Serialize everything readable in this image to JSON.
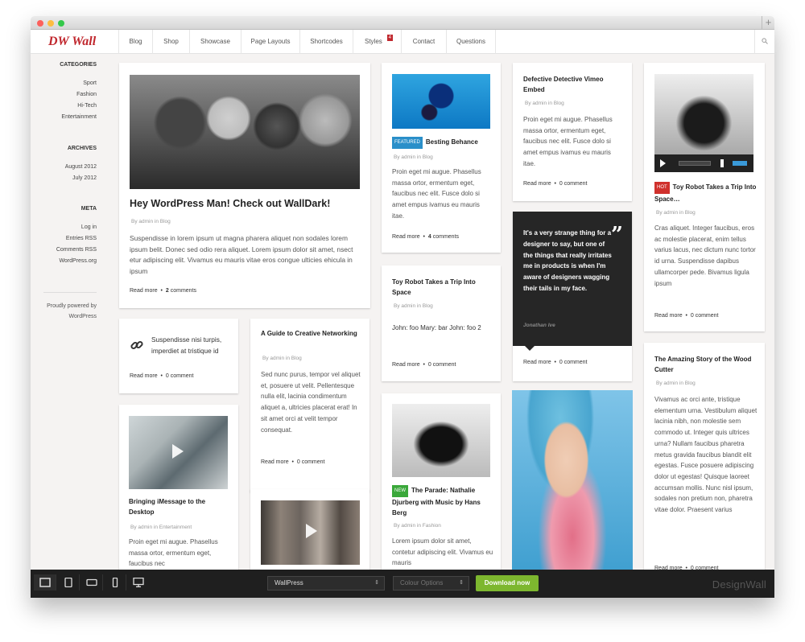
{
  "site": {
    "logo": "DW Wall"
  },
  "nav": {
    "items": [
      "Blog",
      "Shop",
      "Showcase",
      "Page Layouts",
      "Shortcodes",
      "Styles",
      "Contact",
      "Questions"
    ],
    "styles_badge": "4"
  },
  "sidebar": {
    "categories_heading": "CATEGORIES",
    "categories": [
      "Sport",
      "Fashion",
      "Hi-Tech",
      "Entertainment"
    ],
    "archives_heading": "ARCHIVES",
    "archives": [
      "August 2012",
      "July 2012"
    ],
    "meta_heading": "META",
    "meta": [
      "Log in",
      "Entries RSS",
      "Comments RSS",
      "WordPress.org"
    ],
    "powered": [
      "Proudly powered by",
      "WordPress"
    ]
  },
  "posts": {
    "p1": {
      "title": "Hey WordPress Man! Check out WallDark!",
      "meta": "By admin in Blog",
      "body": "Suspendisse in lorem ipsum ut magna pharera aliquet non sodales lorem ipsum belit. Donec sed odio rera aliquet. Lorem ipsum dolor sit amet, nsect etur adipiscing elit. Vivamus eu mauris vitae eros congue ulticies ehicula in ipsum",
      "read": "Read more",
      "sep": "•",
      "comments_num": "2",
      "comments": " comments"
    },
    "p2": {
      "body": "Suspendisse nisi turpis, imperdiet at tristique id",
      "read": "Read more",
      "sep": "•",
      "comments": "0 comment"
    },
    "p3": {
      "title": "A Guide to Creative Networking",
      "meta": "By admin in Blog",
      "body": "Sed nunc purus, tempor vel aliquet et, posuere ut velit. Pellentesque nulla elit, lacinia condimentum aliquet a, ultricies placerat erat! In sit amet orci at velit tempor consequat.",
      "read": "Read more",
      "sep": "•",
      "comments": "0 comment"
    },
    "p4": {
      "title": "Bringing iMessage to the Desktop",
      "meta": "By admin in Entertainment",
      "body": "Proin eget mi augue. Phasellus massa ortor, ermentum eget, faucibus nec"
    },
    "p6": {
      "tag": "FEATURED",
      "tag_color": "#2a8fc9",
      "title": "Besting Behance",
      "meta": "By admin in Blog",
      "body": "Proin eget mi augue. Phasellus massa ortor, ermentum eget, faucibus nec elit. Fusce dolo si amet empus ivamus eu mauris itae.",
      "read": "Read more",
      "sep": "•",
      "comments_num": "4",
      "comments": " comments"
    },
    "p7": {
      "title": "Toy Robot Takes a Trip Into Space",
      "meta": "By admin in Blog",
      "body": "John: foo Mary: bar John: foo 2",
      "read": "Read more",
      "sep": "•",
      "comments": "0 comment"
    },
    "p8": {
      "tag": "NEW",
      "tag_color": "#3aa83a",
      "title": "The Parade: Nathalie Djurberg with Music by Hans Berg",
      "meta": "By admin in Fashion",
      "body": "Lorem ipsum dolor sit amet, contetur adipiscing elit. Vivamus eu mauris"
    },
    "p9": {
      "title": "Defective Detective Vimeo Embed",
      "meta": "By admin in Blog",
      "body": "Proin eget mi augue. Phasellus massa ortor, ermentum eget, faucibus nec elit. Fusce dolo si amet empus ivamus eu mauris itae.",
      "read": "Read more",
      "sep": "•",
      "comments": "0 comment"
    },
    "quote": {
      "text": "It's a very strange thing for a designer to say, but one of the things that really irritates me in products is when I'm aware of designers wagging their tails in my face.",
      "author": "Jonathan Ive",
      "read": "Read more",
      "sep": "•",
      "comments": "0 comment"
    },
    "p11": {
      "tag": "HOT",
      "tag_color": "#d0312d",
      "title": "Toy Robot Takes a Trip Into Space…",
      "meta": "By admin in Blog",
      "body": "Cras aliquet. Integer faucibus, eros ac molestie placerat, enim tellus varius lacus, nec dictum nunc tortor id urna. Suspendisse dapibus ullamcorper pede. Bivamus ligula ipsum",
      "read": "Read more",
      "sep": "•",
      "comments": "0 comment"
    },
    "p12": {
      "title": "The Amazing Story of the Wood Cutter",
      "meta": "By admin in Blog",
      "body": "Vivamus ac orci ante, tristique elementum urna. Vestibulum aliquet lacinia nibh, non molestie sem commodo ut. Integer quis ultrices urna? Nullam faucibus pharetra metus gravida faucibus blandit elit egestas. Fusce posuere adipiscing dolor ut egestas! Quisque laoreet accumsan mollis. Nunc nisl ipsum, sodales non pretium non, pharetra vitae dolor. Praesent varius",
      "read": "Read more",
      "sep": "•",
      "comments": "0 comment"
    }
  },
  "toolbar": {
    "theme_select": "WallPress",
    "colour_select": "Colour Options",
    "download": "Download now",
    "brand": "DesignWall"
  },
  "colors": {
    "accent": "#c0272d",
    "download": "#7db72f",
    "toolbar": "#1f1f1f"
  }
}
